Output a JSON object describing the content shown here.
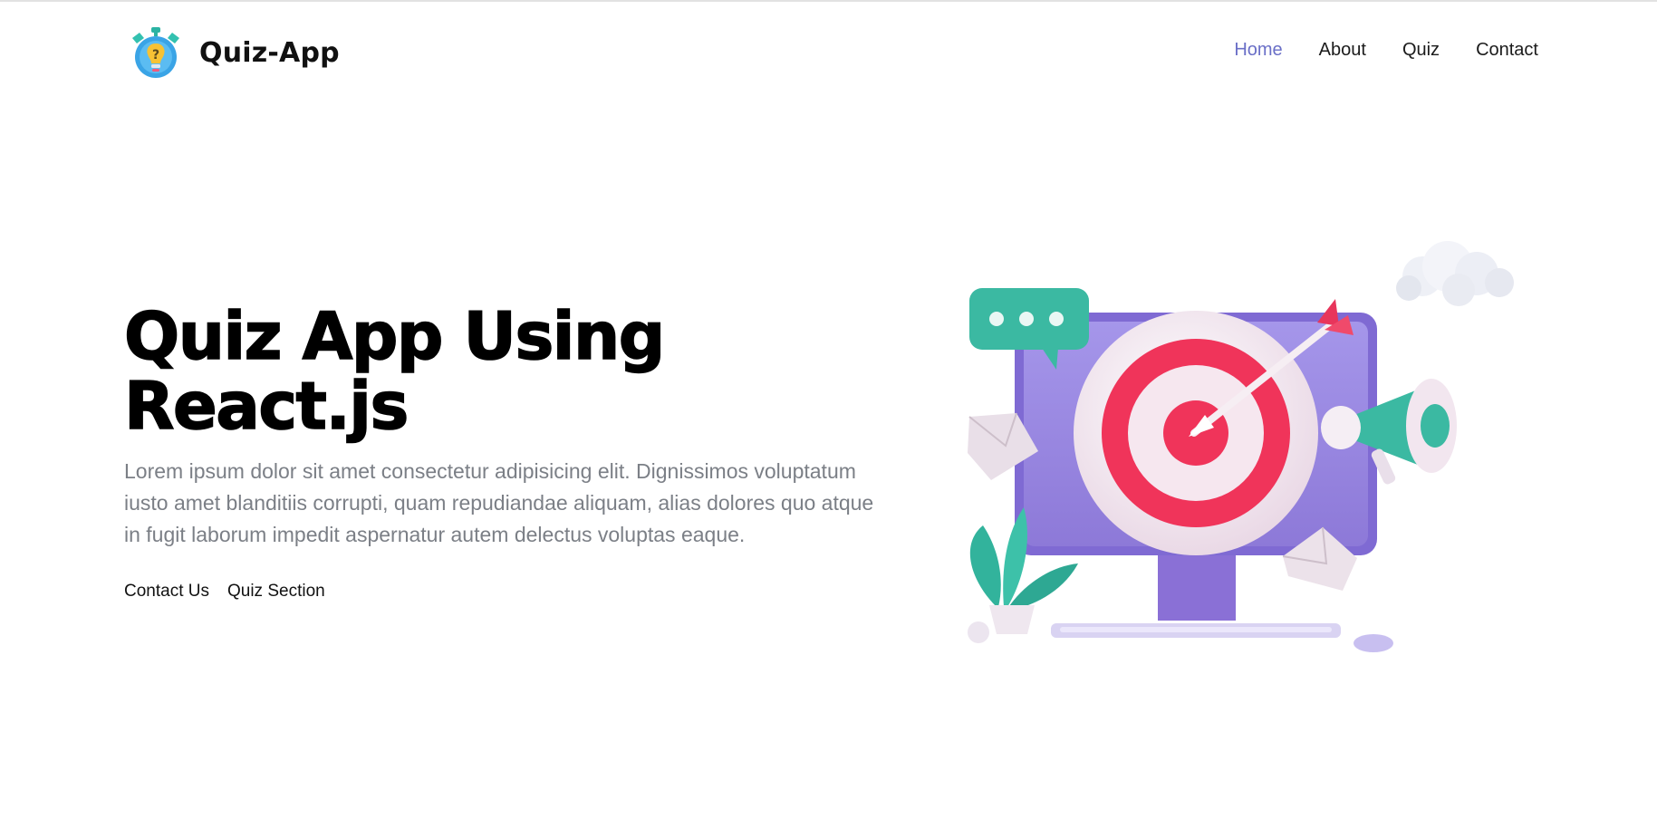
{
  "header": {
    "brand_name": "Quiz-App",
    "logo_icon": "stopwatch-lightbulb-icon"
  },
  "nav": {
    "items": [
      {
        "label": "Home",
        "active": true
      },
      {
        "label": "About",
        "active": false
      },
      {
        "label": "Quiz",
        "active": false
      },
      {
        "label": "Contact",
        "active": false
      }
    ]
  },
  "hero": {
    "title_line1": "Quiz App Using",
    "title_line2": "React.js",
    "description": "Lorem ipsum dolor sit amet consectetur adipisicing elit. Dignissimos voluptatum iusto amet blanditiis corrupti, quam repudiandae aliquam, alias dolores quo atque in fugit laborum impedit aspernatur autem delectus voluptas eaque.",
    "links": {
      "contact": "Contact Us",
      "quiz": "Quiz Section"
    },
    "illustration_icon": "target-monitor-illustration"
  },
  "colors": {
    "nav_active": "#6a6fc7",
    "description_text": "#7b7f86",
    "monitor_purple": "#9b8ae0",
    "target_red": "#f0345a",
    "accent_teal": "#3cbfa6"
  }
}
